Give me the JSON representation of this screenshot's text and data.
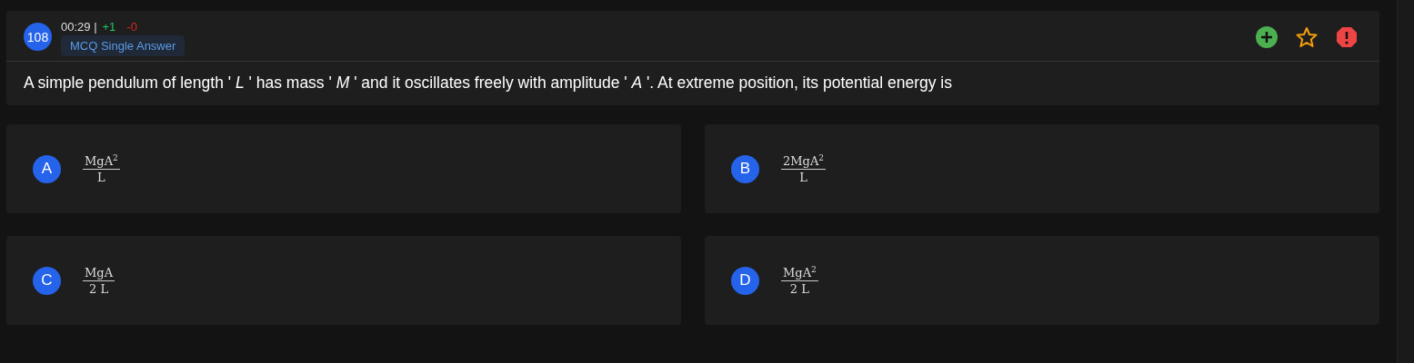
{
  "question": {
    "number": "108",
    "time": "00:29 |",
    "marks_positive": "+1",
    "marks_negative": "-0",
    "type": "MCQ Single Answer",
    "text": "A simple pendulum of length ' *L* ' has mass ' *M* ' and it oscillates freely with amplitude ' *A* '. At extreme position, its potential energy is"
  },
  "options": [
    {
      "label": "A",
      "numerator": "MgA$^{2}$",
      "denominator": "L"
    },
    {
      "label": "B",
      "numerator": "2MgA$^{2}$",
      "denominator": "L"
    },
    {
      "label": "C",
      "numerator": "MgA",
      "denominator": "2 L"
    },
    {
      "label": "D",
      "numerator": "MgA$^{2}$",
      "denominator": "2 L"
    }
  ]
}
